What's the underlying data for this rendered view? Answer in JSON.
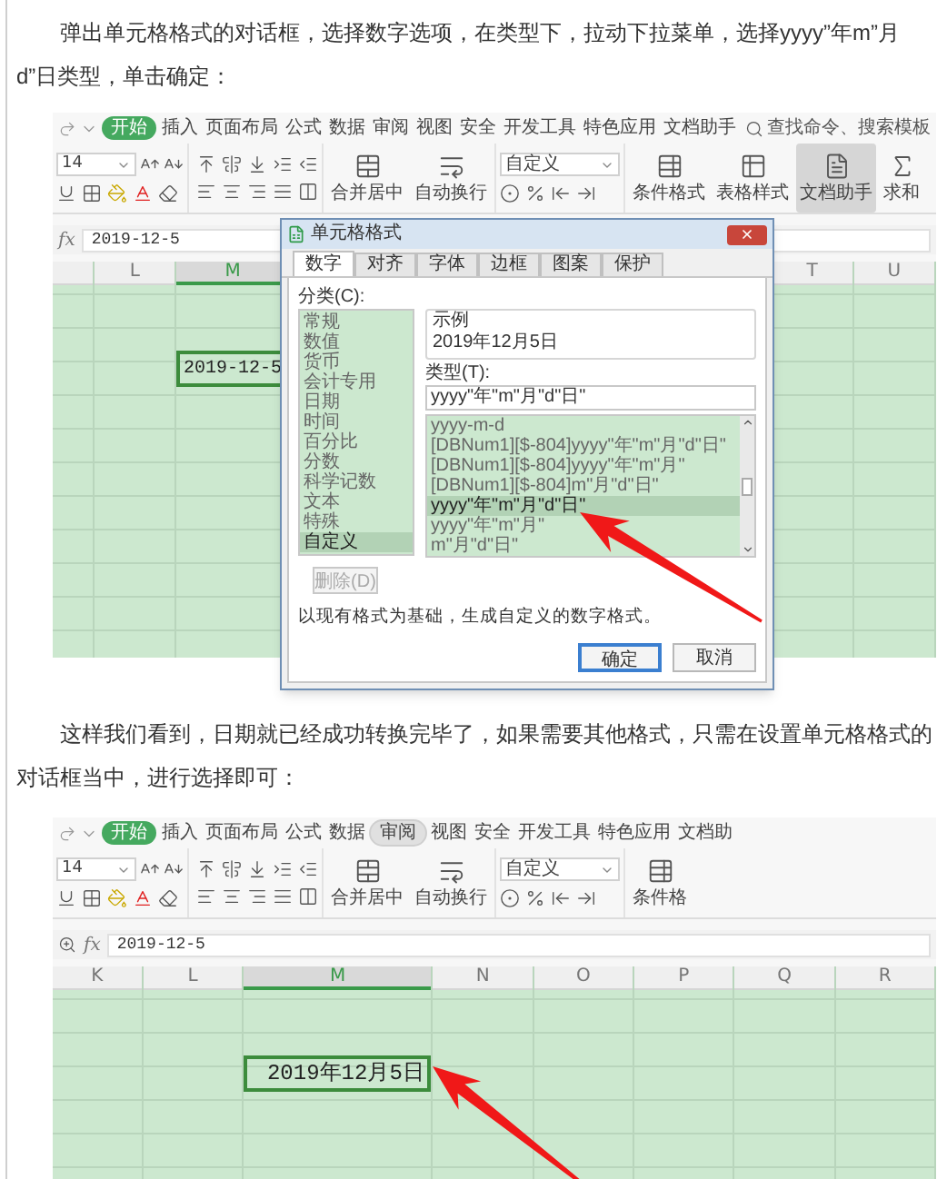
{
  "sections": [
    {
      "paragraph": "弹出单元格格式的对话框，选择数字选项，在类型下，拉动下拉菜单，选择yyyy”年m”月d”日类型，单击确定：",
      "screenshot": {
        "ribbon": {
          "tabs": [
            {
              "label": "开始",
              "selected": true,
              "highlighted": false
            },
            {
              "label": "插入",
              "selected": false,
              "highlighted": false
            },
            {
              "label": "页面布局",
              "selected": false,
              "highlighted": false
            },
            {
              "label": "公式",
              "selected": false,
              "highlighted": false
            },
            {
              "label": "数据",
              "selected": false,
              "highlighted": false
            },
            {
              "label": "审阅",
              "selected": false,
              "highlighted": false
            },
            {
              "label": "视图",
              "selected": false,
              "highlighted": false
            },
            {
              "label": "安全",
              "selected": false,
              "highlighted": false
            },
            {
              "label": "开发工具",
              "selected": false,
              "highlighted": false
            },
            {
              "label": "特色应用",
              "selected": false,
              "highlighted": false
            },
            {
              "label": "文档助手",
              "selected": false,
              "highlighted": false
            }
          ],
          "search": "查找命令、搜索模板",
          "font_size": "14",
          "tools": [
            {
              "kind": "merge",
              "label": "合并居中",
              "selected": false
            },
            {
              "kind": "wrap",
              "label": "自动换行",
              "selected": false
            },
            {
              "kind": "format",
              "label": "自定义",
              "selected": false
            },
            {
              "kind": "conditional",
              "label": "条件格式",
              "selected": false
            },
            {
              "kind": "table",
              "label": "表格样式",
              "selected": false
            },
            {
              "kind": "doc",
              "label": "文档助手",
              "selected": true
            },
            {
              "kind": "sum",
              "label": "求和",
              "selected": false
            }
          ]
        },
        "formula_bar": {
          "label": "fx",
          "value": "2019-12-5",
          "zoom": false
        },
        "columns": [
          {
            "label": "L",
            "selected": false
          },
          {
            "label": "M",
            "selected": true
          },
          {
            "label": "T",
            "selected": false
          },
          {
            "label": "U",
            "selected": false
          }
        ],
        "active_cell": "2019-12-5",
        "dialog": {
          "title": "单元格格式",
          "tabs": [
            {
              "label": "数字",
              "selected": true
            },
            {
              "label": "对齐",
              "selected": false
            },
            {
              "label": "字体",
              "selected": false
            },
            {
              "label": "边框",
              "selected": false
            },
            {
              "label": "图案",
              "selected": false
            },
            {
              "label": "保护",
              "selected": false
            }
          ],
          "category_label": "分类(C):",
          "categories": [
            {
              "label": "常规",
              "selected": false
            },
            {
              "label": "数值",
              "selected": false
            },
            {
              "label": "货币",
              "selected": false
            },
            {
              "label": "会计专用",
              "selected": false
            },
            {
              "label": "日期",
              "selected": false
            },
            {
              "label": "时间",
              "selected": false
            },
            {
              "label": "百分比",
              "selected": false
            },
            {
              "label": "分数",
              "selected": false
            },
            {
              "label": "科学记数",
              "selected": false
            },
            {
              "label": "文本",
              "selected": false
            },
            {
              "label": "特殊",
              "selected": false
            },
            {
              "label": "自定义",
              "selected": true
            }
          ],
          "sample_label": "示例",
          "sample": "2019年12月5日",
          "type_label": "类型(T):",
          "type_value": "yyyy\"年\"m\"月\"d\"日\"",
          "types": [
            {
              "label": "yyyy-m-d",
              "selected": false
            },
            {
              "label": "[DBNum1][$-804]yyyy\"年\"m\"月\"d\"日\"",
              "selected": false
            },
            {
              "label": "[DBNum1][$-804]yyyy\"年\"m\"月\"",
              "selected": false
            },
            {
              "label": "[DBNum1][$-804]m\"月\"d\"日\"",
              "selected": false
            },
            {
              "label": "yyyy\"年\"m\"月\"d\"日\"",
              "selected": true
            },
            {
              "label": "yyyy\"年\"m\"月\"",
              "selected": false
            },
            {
              "label": "m\"月\"d\"日\"",
              "selected": false
            }
          ],
          "delete_button": {
            "label": "删除(D)",
            "disabled": true
          },
          "description": "以现有格式为基础，生成自定义的数字格式。",
          "buttons": [
            {
              "label": "确定",
              "primary": true
            },
            {
              "label": "取消",
              "primary": false
            }
          ]
        }
      }
    },
    {
      "paragraph": "这样我们看到，日期就已经成功转换完毕了，如果需要其他格式，只需在设置单元格格式的对话框当中，进行选择即可：",
      "screenshot": {
        "ribbon": {
          "tabs": [
            {
              "label": "开始",
              "selected": true,
              "highlighted": false
            },
            {
              "label": "插入",
              "selected": false,
              "highlighted": false
            },
            {
              "label": "页面布局",
              "selected": false,
              "highlighted": false
            },
            {
              "label": "公式",
              "selected": false,
              "highlighted": false
            },
            {
              "label": "数据",
              "selected": false,
              "highlighted": false
            },
            {
              "label": "审阅",
              "selected": false,
              "highlighted": true
            },
            {
              "label": "视图",
              "selected": false,
              "highlighted": false
            },
            {
              "label": "安全",
              "selected": false,
              "highlighted": false
            },
            {
              "label": "开发工具",
              "selected": false,
              "highlighted": false
            },
            {
              "label": "特色应用",
              "selected": false,
              "highlighted": false
            },
            {
              "label": "文档助",
              "selected": false,
              "highlighted": false
            }
          ],
          "font_size": "14",
          "tools": [
            {
              "kind": "merge",
              "label": "合并居中",
              "selected": false
            },
            {
              "kind": "wrap",
              "label": "自动换行",
              "selected": false
            },
            {
              "kind": "format",
              "label": "自定义",
              "selected": false
            },
            {
              "kind": "conditional",
              "label": "条件格",
              "selected": false
            }
          ]
        },
        "formula_bar": {
          "label": "fx",
          "value": "2019-12-5",
          "zoom": true
        },
        "columns": [
          {
            "label": "K",
            "selected": false
          },
          {
            "label": "L",
            "selected": false
          },
          {
            "label": "M",
            "selected": true
          },
          {
            "label": "N",
            "selected": false
          },
          {
            "label": "O",
            "selected": false
          },
          {
            "label": "P",
            "selected": false
          },
          {
            "label": "Q",
            "selected": false
          },
          {
            "label": "R",
            "selected": false
          }
        ],
        "active_cell": "2019年12月5日"
      }
    }
  ]
}
